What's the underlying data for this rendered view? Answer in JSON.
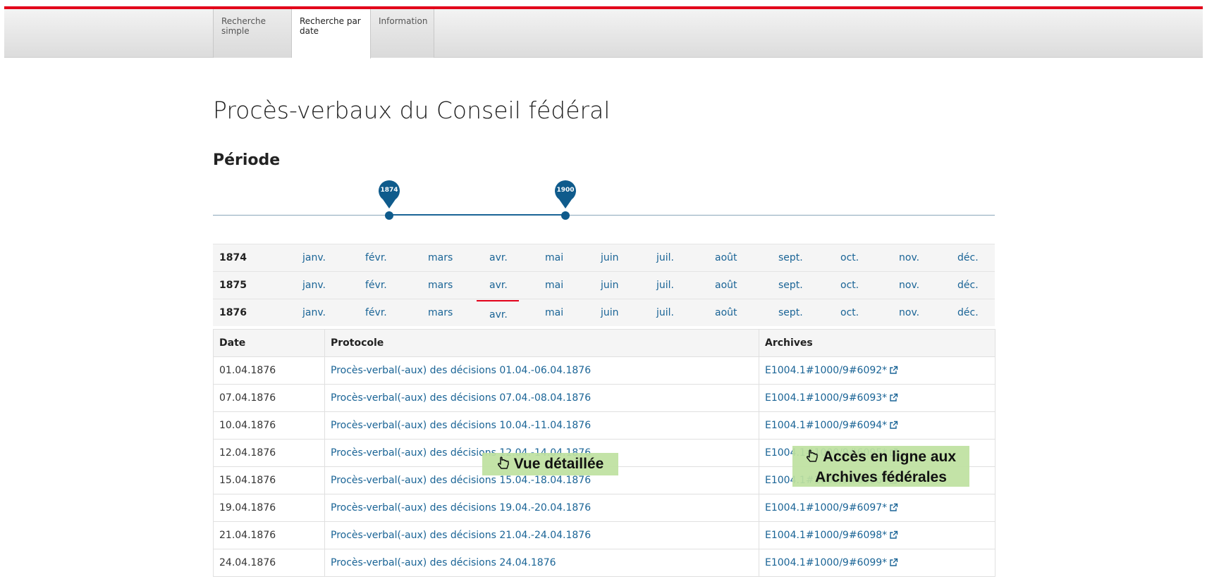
{
  "tabs": [
    {
      "label": "Recherche simple"
    },
    {
      "label": "Recherche par date"
    },
    {
      "label": "Information"
    }
  ],
  "page_title": "Procès-verbaux du Conseil fédéral",
  "period_title": "Période",
  "slider": {
    "min_year_label": "1874",
    "max_year_label": "1900",
    "accent_color": "#0f5b8c"
  },
  "months": [
    "janv.",
    "févr.",
    "mars",
    "avr.",
    "mai",
    "juin",
    "juil.",
    "août",
    "sept.",
    "oct.",
    "nov.",
    "déc."
  ],
  "years": [
    {
      "label": "1874"
    },
    {
      "label": "1875"
    },
    {
      "label": "1876",
      "selected_month": "avr."
    }
  ],
  "table": {
    "headers": {
      "date": "Date",
      "protocol": "Protocole",
      "archives": "Archives"
    },
    "rows": [
      {
        "date": "01.04.1876",
        "protocol": "Procès-verbal(-aux) des décisions 01.04.-06.04.1876",
        "archive": "E1004.1#1000/9#6092*"
      },
      {
        "date": "07.04.1876",
        "protocol": "Procès-verbal(-aux) des décisions 07.04.-08.04.1876",
        "archive": "E1004.1#1000/9#6093*"
      },
      {
        "date": "10.04.1876",
        "protocol": "Procès-verbal(-aux) des décisions 10.04.-11.04.1876",
        "archive": "E1004.1#1000/9#6094*"
      },
      {
        "date": "12.04.1876",
        "protocol": "Procès-verbal(-aux) des décisions 12.04.-14.04.1876",
        "archive": "E1004.1#1000/9#6095*"
      },
      {
        "date": "15.04.1876",
        "protocol": "Procès-verbal(-aux) des décisions 15.04.-18.04.1876",
        "archive": "E1004.1#1000/9#6096*"
      },
      {
        "date": "19.04.1876",
        "protocol": "Procès-verbal(-aux) des décisions 19.04.-20.04.1876",
        "archive": "E1004.1#1000/9#6097*"
      },
      {
        "date": "21.04.1876",
        "protocol": "Procès-verbal(-aux) des décisions 21.04.-24.04.1876",
        "archive": "E1004.1#1000/9#6098*"
      },
      {
        "date": "24.04.1876",
        "protocol": "Procès-verbal(-aux) des décisions 24.04.1876",
        "archive": "E1004.1#1000/9#6099*"
      }
    ]
  },
  "callouts": {
    "detail_view": "Vue détaillée",
    "archives_access_line1": "Accès en ligne aux",
    "archives_access_line2": "Archives fédérales"
  },
  "colors": {
    "brand_red": "#e2001a",
    "link_blue": "#1a6496",
    "callout_green": "#bee1a0"
  }
}
